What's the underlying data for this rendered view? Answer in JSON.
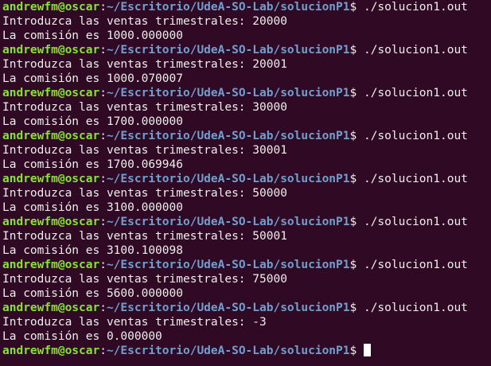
{
  "terminal": {
    "user_host": "andrewfm@oscar",
    "cwd": "~/Escritorio/UdeA-SO-Lab/solucionP1",
    "prompt_suffix": "$",
    "runs": [
      {
        "command": "./solucion1.out",
        "input_prompt": "Introduzca las ventas trimestrales: 20000",
        "result": "La comisión es 1000.000000"
      },
      {
        "command": "./solucion1.out",
        "input_prompt": "Introduzca las ventas trimestrales: 20001",
        "result": "La comisión es 1000.070007"
      },
      {
        "command": "./solucion1.out",
        "input_prompt": "Introduzca las ventas trimestrales: 30000",
        "result": "La comisión es 1700.000000"
      },
      {
        "command": "./solucion1.out",
        "input_prompt": "Introduzca las ventas trimestrales: 30001",
        "result": "La comisión es 1700.069946"
      },
      {
        "command": "./solucion1.out",
        "input_prompt": "Introduzca las ventas trimestrales: 50000",
        "result": "La comisión es 3100.000000"
      },
      {
        "command": "./solucion1.out",
        "input_prompt": "Introduzca las ventas trimestrales: 50001",
        "result": "La comisión es 3100.100098"
      },
      {
        "command": "./solucion1.out",
        "input_prompt": "Introduzca las ventas trimestrales: 75000",
        "result": "La comisión es 5600.000000"
      },
      {
        "command": "./solucion1.out",
        "input_prompt": "Introduzca las ventas trimestrales: -3",
        "result": "La comisión es 0.000000"
      }
    ],
    "colors": {
      "background": "#300a24",
      "user_host": "#8ae234",
      "path": "#729fcf",
      "text": "#eeeeec"
    }
  }
}
